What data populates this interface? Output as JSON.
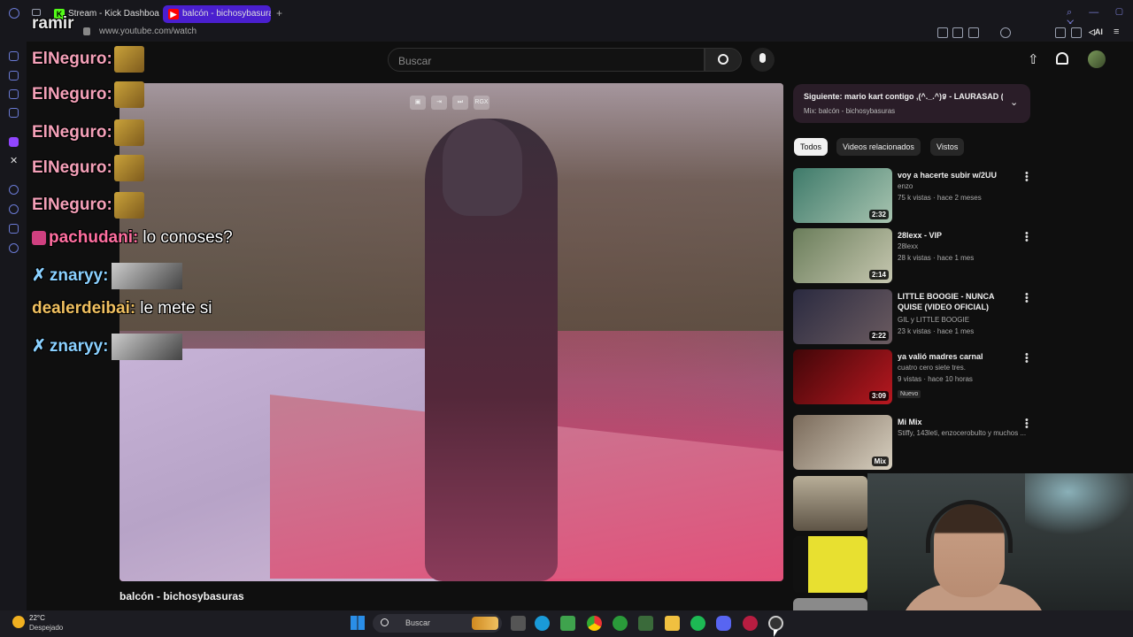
{
  "browser": {
    "tabs": [
      {
        "label": "Stream - Kick Dashboard",
        "icon": "kick-icon",
        "active": false
      },
      {
        "label": "balcón - bichosybasura",
        "icon": "youtube-icon",
        "active": true
      }
    ],
    "url": "www.youtube.com/watch"
  },
  "youtube": {
    "search_placeholder": "Buscar",
    "video_title": "balcón - bichosybasuras",
    "overlay_btn_label": "RGX",
    "up_next": {
      "title": "Siguiente: mario kart contigo ,(^._.^)ទ - LAURASAD (V...",
      "subtitle": "Mix: balcón - bichosybasuras"
    },
    "chips": [
      "Todos",
      "Videos relacionados",
      "Vistos"
    ],
    "related": [
      {
        "title": "voy a hacerte subir  w/2UU",
        "channel": "enzo",
        "stats": "75 k vistas · hace 2 meses",
        "duration": "2:32",
        "colors": [
          "#3e7a6a",
          "#a8c4b0"
        ]
      },
      {
        "title": "28lexx - VIP",
        "channel": "28lexx",
        "stats": "28 k vistas · hace 1 mes",
        "duration": "2:14",
        "colors": [
          "#6a7d5a",
          "#c6c7b0"
        ]
      },
      {
        "title": "LITTLE BOOGIE - NUNCA QUISE (VIDEO OFICIAL)",
        "channel": "GIL y LITTLE BOOGIE",
        "stats": "23 k vistas · hace 1 mes",
        "duration": "2:22",
        "colors": [
          "#2a2a40",
          "#6b5b60"
        ]
      },
      {
        "title": "ya valió madres carnal",
        "channel": "cuatro cero siete tres.",
        "stats": "9 vistas · hace 10 horas",
        "duration": "3:09",
        "badge": "Nuevo",
        "colors": [
          "#400608",
          "#b81820"
        ]
      },
      {
        "title": "Mi Mix",
        "channel": "Stiffy, 143leti, enzocerobulto y muchos ...",
        "stats": "",
        "duration": "Mix",
        "colors": [
          "#7a6a5a",
          "#d8d0c0"
        ]
      }
    ]
  },
  "chat": [
    {
      "user": "ramir",
      "color": "#e8e8e8",
      "text": "",
      "emote": "none",
      "badge": ""
    },
    {
      "user": "ElNeguro:",
      "color": "#f4a0b8",
      "text": "",
      "emote": "gold",
      "badge": ""
    },
    {
      "user": "ElNeguro:",
      "color": "#f4a0b8",
      "text": "",
      "emote": "gold",
      "badge": ""
    },
    {
      "user": "ElNeguro:",
      "color": "#f4a0b8",
      "text": "",
      "emote": "gold",
      "badge": ""
    },
    {
      "user": "ElNeguro:",
      "color": "#f4a0b8",
      "text": "",
      "emote": "gold",
      "badge": ""
    },
    {
      "user": "ElNeguro:",
      "color": "#f4a0b8",
      "text": "",
      "emote": "gold",
      "badge": ""
    },
    {
      "user": "pachudani:",
      "color": "#ff6fa0",
      "text": "lo conoses?",
      "emote": "none",
      "badge": "#d04080"
    },
    {
      "user": "znaryy:",
      "color": "#8ad0ff",
      "text": "",
      "emote": "gray",
      "badge": "sword"
    },
    {
      "user": "dealerdeibai:",
      "color": "#f0c060",
      "text": "le mete si",
      "emote": "none",
      "badge": ""
    },
    {
      "user": "znaryy:",
      "color": "#8ad0ff",
      "text": "",
      "emote": "gray",
      "badge": "sword"
    }
  ],
  "taskbar": {
    "weather_temp": "22°C",
    "weather_desc": "Despejado",
    "search_label": "Buscar"
  },
  "colors": {
    "accent": "#ff0000",
    "chip_active": "#f1f1f1"
  }
}
